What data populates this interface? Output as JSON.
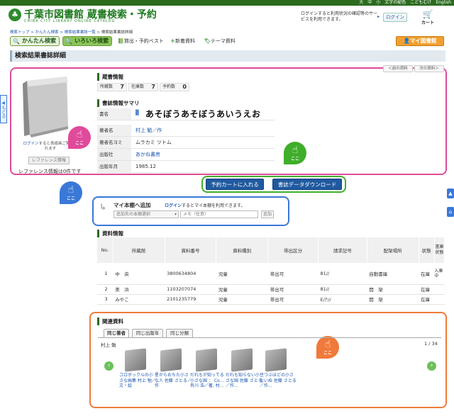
{
  "header": {
    "util_links": [
      "大",
      "中",
      "小",
      "文字の配色",
      "こどもむけ",
      "English"
    ],
    "title": "千葉市図書館 蔵書検索・予約",
    "subtitle": "CHIBA CITY LIBRARY ONLINE CATALOG",
    "login_message": "ログインすると利用状況の確認等のサービスを利用できます。",
    "login_label": "ログイン",
    "cart_label": "カート"
  },
  "breadcrumb": {
    "items": [
      "検索トップ",
      "かんたん検索",
      "検索結果書誌一覧"
    ],
    "current": "検索結果書誌詳細",
    "sep": " > "
  },
  "nav": {
    "tab_easy": "かんたん検索",
    "tab_various": "いろいろ検索",
    "link_best": "貸出・予約ベスト",
    "link_new": "新着資料",
    "link_theme": "テーマ資料",
    "mylib": "マイ図書館"
  },
  "page_title": "検索結果書誌詳細",
  "pager": {
    "prev": "＜前の資料",
    "next": "次の資料＞"
  },
  "holding": {
    "heading": "蔵書情報",
    "items": [
      {
        "label": "所蔵数",
        "value": "7"
      },
      {
        "label": "在庫数",
        "value": "7"
      },
      {
        "label": "予約数",
        "value": "0"
      }
    ]
  },
  "summary": {
    "heading": "書誌情報サマリ",
    "rows": [
      {
        "key": "書名",
        "value": "あそぼうあそぼうあいうえお"
      },
      {
        "key": "著者名",
        "value": "村上 勉／作"
      },
      {
        "key": "著者名ヨミ",
        "value": "ムラカミ ツトム"
      },
      {
        "key": "出版社",
        "value": "あかね書房"
      },
      {
        "key": "出版年月",
        "value": "1985.12"
      }
    ]
  },
  "book_panel": {
    "login_prefix": "ログイン",
    "login_suffix": "すると表紙画ご覧になれます",
    "reference_button": "レファレンス情報",
    "reference_note": "レファレンス情報は0件です"
  },
  "here_label": "ここ",
  "actions": {
    "reserve": "予約カートに入れる",
    "download": "書誌データダウンロード"
  },
  "mybook": {
    "heading": "マイ本棚へ追加",
    "login": "ログイン",
    "note": "するとマイ本棚を利用できます。",
    "select_placeholder": "追加先の本棚選択",
    "memo_placeholder": "メモ（任意）",
    "add": "追加"
  },
  "shiryo": {
    "heading": "資料情報",
    "columns": [
      "No.",
      "所蔵館",
      "資料番号",
      "資料種別",
      "帯出区分",
      "請求記号",
      "配架場所",
      "状態",
      "書庫状態"
    ],
    "rows": [
      [
        "1",
        "中　央",
        "3800634804",
        "児童",
        "帯出可",
        "81//",
        "自動書庫",
        "在庫",
        "入庫中"
      ],
      [
        "2",
        "美　浜",
        "1103207074",
        "児童",
        "帯出可",
        "81//",
        "開　架",
        "在庫",
        ""
      ],
      [
        "3",
        "みやこ",
        "2101235779",
        "児童",
        "帯出可",
        "E/ｱｿ/",
        "開　架",
        "在庫",
        ""
      ]
    ]
  },
  "related": {
    "heading": "関連資料",
    "tabs": [
      "同じ著者",
      "同じ出版年",
      "同じ分類"
    ],
    "author": "村上 勉",
    "page": "1 / 34",
    "items": [
      "コロボックルの小さな画集 村上 勉／文・絵",
      "星からおちた小さな人 佐藤 さとる／作",
      "だれもが知ってる小さな国 ： Co... 有川 浩／著, 村...",
      "だれも知らない小さな国 佐藤 さとる／作...",
      "豆つぶほどの小さないぬ 佐藤 さとる／作..."
    ]
  },
  "colors": {
    "green": "#2b6b1e",
    "pink": "#e04a9a",
    "blue": "#3a78d8",
    "orange": "#f07a3a"
  }
}
